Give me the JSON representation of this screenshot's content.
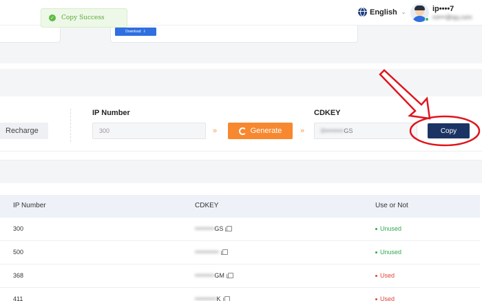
{
  "toast": {
    "text": "Copy Success"
  },
  "header": {
    "language": "English",
    "user_name": "ip••••7",
    "user_email": "mi•••@qq.com"
  },
  "top_card": {
    "download_label": "Download"
  },
  "recharge": {
    "button_label": "Recharge",
    "ip_label": "IP Number",
    "ip_value": "300",
    "generate_label": "Generate",
    "cdkey_label": "CDKEY",
    "cdkey_value_visible": "GS",
    "cdkey_value_hidden": "II•••••••••",
    "copy_label": "Copy"
  },
  "table": {
    "headers": [
      "IP Number",
      "CDKEY",
      "Use or Not"
    ],
    "rows": [
      {
        "ip": "300",
        "cdkey_hidden": "•••••••••",
        "cdkey_visible": "GS",
        "status": "Unused",
        "status_color": "#2fa84f"
      },
      {
        "ip": "500",
        "cdkey_hidden": "•••••••••••",
        "cdkey_visible": "",
        "status": "Unused",
        "status_color": "#2fa84f"
      },
      {
        "ip": "368",
        "cdkey_hidden": "•••••••••",
        "cdkey_visible": "GM",
        "status": "Used",
        "status_color": "#e0453a"
      },
      {
        "ip": "411",
        "cdkey_hidden": "••••••••••",
        "cdkey_visible": "K",
        "status": "Used",
        "status_color": "#e0453a"
      }
    ]
  },
  "colors": {
    "accent_orange": "#f7882f",
    "copy_navy": "#1b3464",
    "annotation_red": "#e0141c",
    "success_green": "#5dbb3f"
  }
}
